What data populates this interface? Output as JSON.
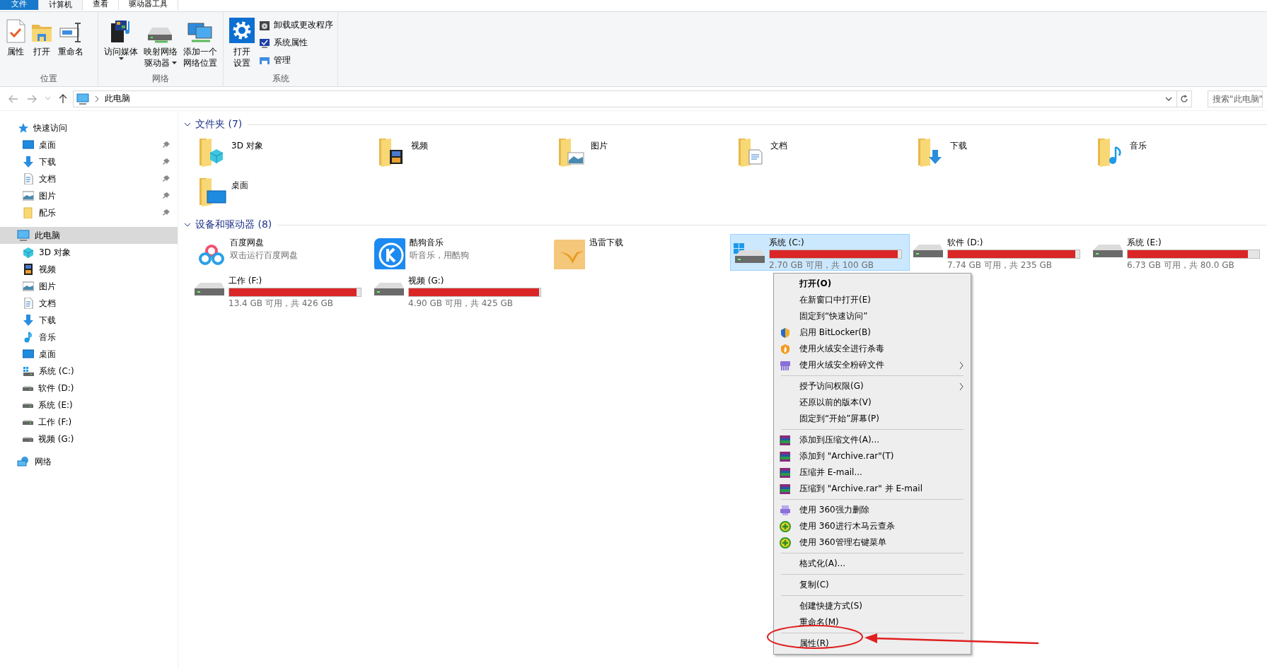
{
  "ribbon": {
    "tabs": [
      {
        "label": "文件",
        "kind": "file",
        "selected": false
      },
      {
        "label": "计算机",
        "kind": "tab",
        "selected": true
      },
      {
        "label": "查看",
        "kind": "tab",
        "selected": false
      },
      {
        "label": "驱动器工具",
        "kind": "tab",
        "selected": false
      }
    ],
    "groups": [
      {
        "label": "位置",
        "buttons": [
          {
            "kind": "large",
            "lines": [
              "属性"
            ],
            "dropdown": false
          },
          {
            "kind": "large",
            "lines": [
              "打开"
            ],
            "dropdown": false
          },
          {
            "kind": "large",
            "lines": [
              "重命名"
            ],
            "dropdown": false
          }
        ]
      },
      {
        "label": "网络",
        "buttons": [
          {
            "kind": "large",
            "lines": [
              "访问媒体"
            ],
            "dropdown": true
          },
          {
            "kind": "large",
            "lines": [
              "映射网络",
              "驱动器"
            ],
            "dropdown": true
          },
          {
            "kind": "large",
            "lines": [
              "添加一个",
              "网络位置"
            ],
            "dropdown": false
          }
        ]
      },
      {
        "label": "系统",
        "buttons": [
          {
            "kind": "large",
            "lines": [
              "打开",
              "设置"
            ],
            "dropdown": false
          },
          {
            "kind": "small",
            "lines": [
              "卸载或更改程序"
            ],
            "dropdown": false
          },
          {
            "kind": "small",
            "lines": [
              "系统属性"
            ],
            "dropdown": false
          },
          {
            "kind": "small",
            "lines": [
              "管理"
            ],
            "dropdown": false
          }
        ]
      }
    ]
  },
  "address_bar": {
    "path": [
      "此电脑"
    ],
    "search": {
      "placeholder": "搜索\"此电脑\""
    }
  },
  "navigation": {
    "items": [
      {
        "label": "快速访问",
        "selected": false,
        "children": [
          {
            "label": "桌面",
            "pinned": true,
            "selected": false
          },
          {
            "label": "下载",
            "pinned": true,
            "selected": false
          },
          {
            "label": "文档",
            "pinned": true,
            "selected": false
          },
          {
            "label": "图片",
            "pinned": true,
            "selected": false
          },
          {
            "label": "配乐",
            "pinned": true,
            "selected": false
          }
        ]
      },
      {
        "label": "此电脑",
        "selected": true,
        "children": [
          {
            "label": "3D 对象",
            "pinned": false,
            "selected": false
          },
          {
            "label": "视频",
            "pinned": false,
            "selected": false
          },
          {
            "label": "图片",
            "pinned": false,
            "selected": false
          },
          {
            "label": "文档",
            "pinned": false,
            "selected": false
          },
          {
            "label": "下载",
            "pinned": false,
            "selected": false
          },
          {
            "label": "音乐",
            "pinned": false,
            "selected": false
          },
          {
            "label": "桌面",
            "pinned": false,
            "selected": false
          },
          {
            "label": "系统 (C:)",
            "pinned": false,
            "selected": false
          },
          {
            "label": "软件 (D:)",
            "pinned": false,
            "selected": false
          },
          {
            "label": "系统 (E:)",
            "pinned": false,
            "selected": false
          },
          {
            "label": "工作 (F:)",
            "pinned": false,
            "selected": false
          },
          {
            "label": "视频 (G:)",
            "pinned": false,
            "selected": false
          }
        ]
      },
      {
        "label": "网络",
        "selected": false
      }
    ]
  },
  "sections": [
    {
      "title": "文件夹 (7)",
      "expanded": true,
      "items": [
        {
          "kind": "folder",
          "name": "3D 对象",
          "selected": false
        },
        {
          "kind": "folder",
          "name": "视频",
          "selected": false
        },
        {
          "kind": "folder",
          "name": "图片",
          "selected": false
        },
        {
          "kind": "folder",
          "name": "文档",
          "selected": false
        },
        {
          "kind": "folder",
          "name": "下载",
          "selected": false
        },
        {
          "kind": "folder",
          "name": "音乐",
          "selected": false
        },
        {
          "kind": "folder",
          "name": "桌面",
          "selected": false
        }
      ]
    },
    {
      "title": "设备和驱动器 (8)",
      "expanded": true,
      "items": [
        {
          "kind": "app",
          "name": "百度网盘",
          "subtitle": "双击运行百度网盘",
          "selected": false
        },
        {
          "kind": "app",
          "name": "酷狗音乐",
          "subtitle": "听音乐，用酷狗",
          "selected": false
        },
        {
          "kind": "app",
          "name": "迅雷下载",
          "selected": false
        },
        {
          "kind": "drive",
          "name": "系统 (C:)",
          "level": 0.973,
          "free": "2.70 GB 可用，共 100 GB",
          "selected": true
        },
        {
          "kind": "drive",
          "name": "软件 (D:)",
          "level": 0.967,
          "free": "7.74 GB 可用，共 235 GB",
          "selected": false
        },
        {
          "kind": "drive",
          "name": "系统 (E:)",
          "level": 0.916,
          "free": "6.73 GB 可用，共 80.0 GB",
          "selected": false
        },
        {
          "kind": "drive",
          "name": "工作 (F:)",
          "level": 0.969,
          "free": "13.4 GB 可用，共 426 GB",
          "selected": false
        },
        {
          "kind": "drive",
          "name": "视频 (G:)",
          "level": 0.988,
          "free": "4.90 GB 可用，共 425 GB",
          "selected": false
        }
      ]
    }
  ],
  "context_menu": {
    "items": [
      {
        "kind": "item",
        "label": "打开(O)",
        "default": true,
        "submenu": false
      },
      {
        "kind": "item",
        "label": "在新窗口中打开(E)",
        "default": false,
        "submenu": false
      },
      {
        "kind": "item",
        "label": "固定到“快速访问”",
        "default": false,
        "submenu": false
      },
      {
        "kind": "item",
        "label": "启用 BitLocker(B)",
        "default": false,
        "submenu": false
      },
      {
        "kind": "item",
        "label": "使用火绒安全进行杀毒",
        "default": false,
        "submenu": false
      },
      {
        "kind": "item",
        "label": "使用火绒安全粉碎文件",
        "default": false,
        "submenu": true
      },
      {
        "kind": "separator"
      },
      {
        "kind": "item",
        "label": "授予访问权限(G)",
        "default": false,
        "submenu": true
      },
      {
        "kind": "item",
        "label": "还原以前的版本(V)",
        "default": false,
        "submenu": false
      },
      {
        "kind": "item",
        "label": "固定到“开始”屏幕(P)",
        "default": false,
        "submenu": false
      },
      {
        "kind": "separator"
      },
      {
        "kind": "item",
        "label": "添加到压缩文件(A)...",
        "default": false,
        "submenu": false
      },
      {
        "kind": "item",
        "label": "添加到 \"Archive.rar\"(T)",
        "default": false,
        "submenu": false
      },
      {
        "kind": "item",
        "label": "压缩并 E-mail...",
        "default": false,
        "submenu": false
      },
      {
        "kind": "item",
        "label": "压缩到 \"Archive.rar\" 并 E-mail",
        "default": false,
        "submenu": false
      },
      {
        "kind": "separator"
      },
      {
        "kind": "item",
        "label": "使用 360强力删除",
        "default": false,
        "submenu": false
      },
      {
        "kind": "item",
        "label": "使用 360进行木马云查杀",
        "default": false,
        "submenu": false
      },
      {
        "kind": "item",
        "label": "使用 360管理右键菜单",
        "default": false,
        "submenu": false
      },
      {
        "kind": "separator"
      },
      {
        "kind": "item",
        "label": "格式化(A)...",
        "default": false,
        "submenu": false
      },
      {
        "kind": "separator"
      },
      {
        "kind": "item",
        "label": "复制(C)",
        "default": false,
        "submenu": false
      },
      {
        "kind": "separator"
      },
      {
        "kind": "item",
        "label": "创建快捷方式(S)",
        "default": false,
        "submenu": false
      },
      {
        "kind": "item",
        "label": "重命名(M)",
        "default": false,
        "submenu": false
      },
      {
        "kind": "separator"
      },
      {
        "kind": "item",
        "label": "属性(R)",
        "default": false,
        "submenu": false
      }
    ]
  }
}
